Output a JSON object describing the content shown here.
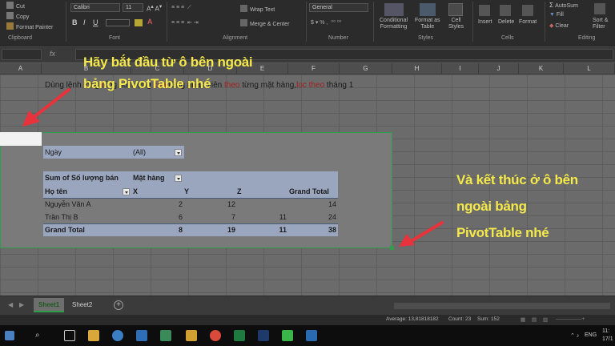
{
  "ribbon": {
    "cut": "Cut",
    "copy": "Copy",
    "format_painter": "Format Painter",
    "clipboard": "Clipboard",
    "font_name": "Calibri",
    "font_size": "11",
    "font_group": "Font",
    "wrap_text": "Wrap Text",
    "merge_center": "Merge & Center",
    "alignment": "Alignment",
    "number_format": "General",
    "number_group": "Number",
    "conditional": "Conditional\nFormatting",
    "format_as_table": "Format as\nTable",
    "cell_styles": "Cell\nStyles",
    "styles_group": "Styles",
    "insert": "Insert",
    "delete": "Delete",
    "format": "Format",
    "cells_group": "Cells",
    "autosum": "AutoSum",
    "fill": "Fill",
    "clear": "Clear",
    "sort_filter": "Sort &\nFilter",
    "editing_group": "Editing"
  },
  "formula_bar": {
    "fx": "fx"
  },
  "columns": [
    "A",
    "B",
    "C",
    "D",
    "E",
    "F",
    "G",
    "H",
    "I",
    "J",
    "K",
    "L"
  ],
  "sheet": {
    "title_parts": [
      {
        "text": "Dùng lệnh ",
        "color": "#1a1a1a"
      },
      {
        "text": "t",
        "color": "#a02020"
      },
      {
        "text": "ổng ",
        "color": "#1a1a1a"
      },
      {
        "text": "t",
        "color": "#a02020"
      },
      {
        "text": "ổng số lượng ",
        "color": "#1a1a1a"
      },
      {
        "text": "của",
        "color": "#a02020"
      },
      {
        "text": " từng nhân viên ",
        "color": "#1a1a1a"
      },
      {
        "text": "theo",
        "color": "#a02020"
      },
      {
        "text": " từng mặt hàng,",
        "color": "#1a1a1a"
      },
      {
        "text": "lọc theo",
        "color": "#a02020"
      },
      {
        "text": " tháng 1",
        "color": "#1a1a1a"
      }
    ],
    "pivot": {
      "filter_label": "Ngày",
      "filter_value": "(All)",
      "sum_label": "Sum of Số lượng bán",
      "col_label": "Mặt hàng",
      "row_label": "Họ tên",
      "headers": [
        "X",
        "Y",
        "Z",
        "Grand Total"
      ],
      "rows": [
        {
          "name": "Nguyễn Văn A",
          "values": [
            "2",
            "12",
            "",
            "14"
          ]
        },
        {
          "name": "Trần Thị B",
          "values": [
            "6",
            "7",
            "11",
            "24"
          ]
        }
      ],
      "total_label": "Grand Total",
      "total_values": [
        "8",
        "19",
        "11",
        "38"
      ]
    }
  },
  "annotations": {
    "start_line1": "Hãy bắt đầu từ ô bên ngoài",
    "start_line2": "bảng PivotTable nhé",
    "end_line1": "Và kết thúc ở ô bên",
    "end_line2": "ngoài bảng",
    "end_line3": "PivotTable nhé",
    "text_color": "#f4e84a",
    "arrow_color": "#e8323c"
  },
  "tabs": {
    "sheet1": "Sheet1",
    "sheet2": "Sheet2",
    "add": "+"
  },
  "status": {
    "average": "Average: 13,81818182",
    "count": "Count: 23",
    "sum": "Sum: 152"
  },
  "taskbar": {
    "lang": "ENG",
    "time": "11:",
    "date": "17/1"
  }
}
